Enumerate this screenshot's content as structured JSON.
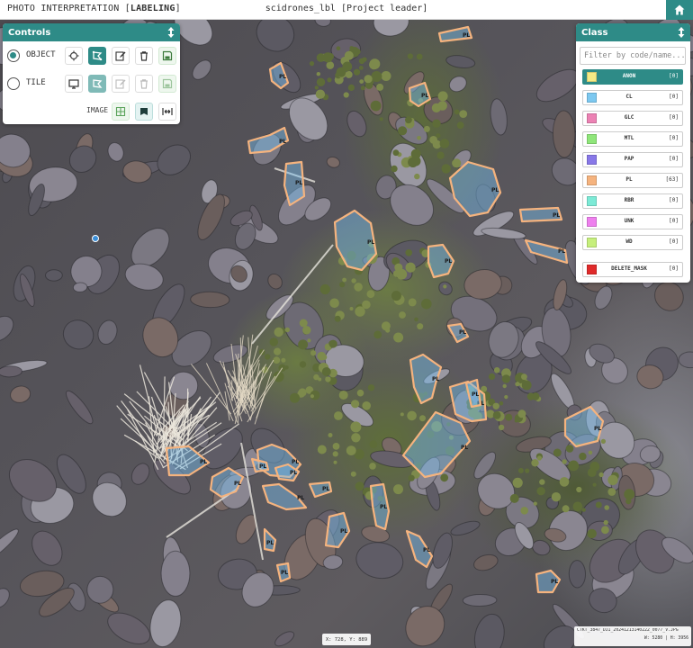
{
  "topbar": {
    "mode_prefix": "PHOTO INTERPRETATION [",
    "mode_value": "LABELING",
    "mode_suffix": "]",
    "project": "scidrones_lbl [Project leader]",
    "home_icon": "home-icon"
  },
  "controls": {
    "title": "Controls",
    "rows": [
      {
        "label": "OBJECT",
        "selected": true
      },
      {
        "label": "TILE",
        "selected": false
      }
    ],
    "image_label": "IMAGE"
  },
  "class_panel": {
    "title": "Class",
    "filter_placeholder": "Filter by code/name...",
    "classes": [
      {
        "code": "ANON",
        "count": "[0]",
        "color": "#f4ea85",
        "selected": true
      },
      {
        "code": "CL",
        "count": "[0]",
        "color": "#7cc8f0",
        "selected": false
      },
      {
        "code": "GLC",
        "count": "[0]",
        "color": "#ec82b4",
        "selected": false
      },
      {
        "code": "MTL",
        "count": "[0]",
        "color": "#8fe67a",
        "selected": false
      },
      {
        "code": "PAP",
        "count": "[0]",
        "color": "#8878e8",
        "selected": false
      },
      {
        "code": "PL",
        "count": "[63]",
        "color": "#f5b37e",
        "selected": false
      },
      {
        "code": "RBR",
        "count": "[0]",
        "color": "#7cead6",
        "selected": false
      },
      {
        "code": "UNK",
        "count": "[0]",
        "color": "#ee80ee",
        "selected": false
      },
      {
        "code": "WD",
        "count": "[0]",
        "color": "#c6ef7c",
        "selected": false
      },
      {
        "code": "DELETE_MASK",
        "count": "[0]",
        "color": "#e02a2a",
        "selected": false
      }
    ]
  },
  "annotation": {
    "label": "PL",
    "color": "#f5b37e"
  },
  "cursor": {
    "label": "X: 728, Y: 889"
  },
  "file": {
    "name": "CTKT_3847_DJI_20241213140222_0077_V.JPG",
    "dims": "W: 5280 | H: 3956"
  }
}
